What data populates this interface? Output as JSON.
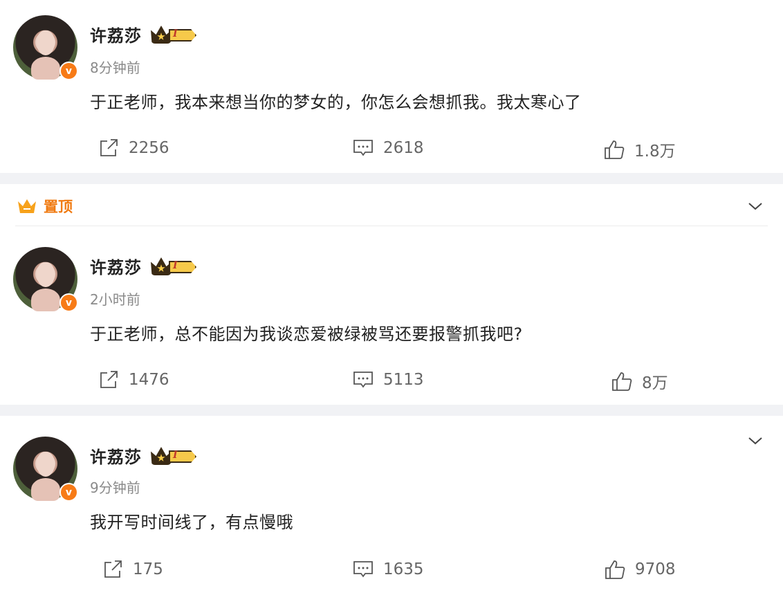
{
  "posts": [
    {
      "username": "许荔莎",
      "vip_level": "I",
      "time": "8分钟前",
      "content": "于正老师，我本来想当你的梦女的，你怎么会想抓我。我太寒心了",
      "share_count": "2256",
      "comment_count": "2618",
      "like_count": "1.8万"
    },
    {
      "username": "许荔莎",
      "vip_level": "I",
      "time": "2小时前",
      "content": "于正老师，总不能因为我谈恋爱被绿被骂还要报警抓我吧?",
      "share_count": "1476",
      "comment_count": "5113",
      "like_count": "8万"
    },
    {
      "username": "许荔莎",
      "vip_level": "I",
      "time": "9分钟前",
      "content": "我开写时间线了，有点慢哦",
      "share_count": "175",
      "comment_count": "1635",
      "like_count": "9708"
    }
  ],
  "pinned": {
    "label": "置顶"
  },
  "verified_badge": "v",
  "colors": {
    "accent": "#f07b12",
    "separator": "#f1f2f5",
    "text": "#222222",
    "muted": "#8a8a8a"
  },
  "icons": [
    "share-icon",
    "comment-icon",
    "like-icon",
    "chevron-down-icon",
    "crown-icon"
  ]
}
